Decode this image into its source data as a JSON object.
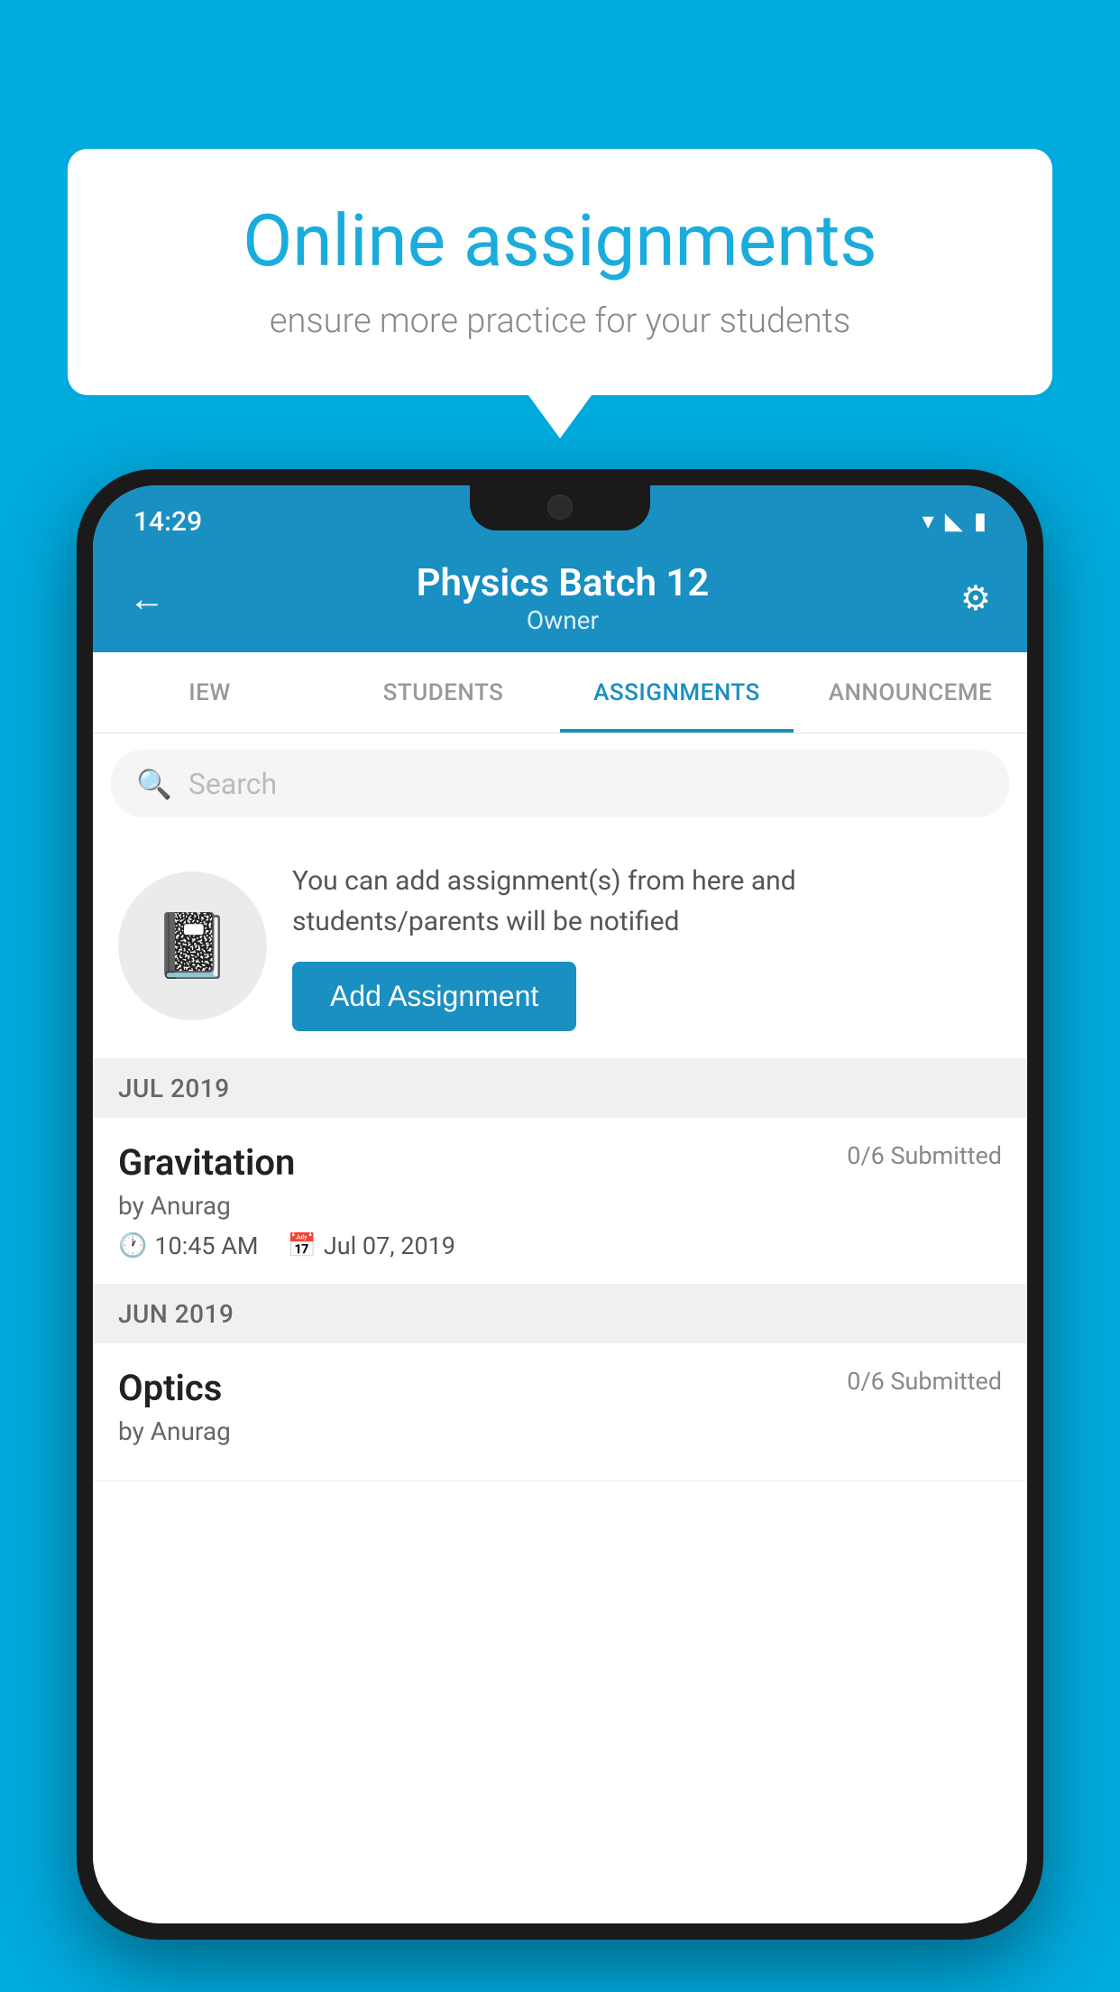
{
  "background_color": "#00AADD",
  "speech_bubble": {
    "title": "Online assignments",
    "subtitle": "ensure more practice for your students"
  },
  "status_bar": {
    "time": "14:29",
    "icons": [
      "wifi",
      "signal",
      "battery"
    ]
  },
  "header": {
    "title": "Physics Batch 12",
    "subtitle": "Owner",
    "back_label": "←",
    "settings_label": "⚙"
  },
  "tabs": [
    {
      "id": "iew",
      "label": "IEW",
      "active": false
    },
    {
      "id": "students",
      "label": "STUDENTS",
      "active": false
    },
    {
      "id": "assignments",
      "label": "ASSIGNMENTS",
      "active": true
    },
    {
      "id": "announcements",
      "label": "ANNOUNCEMENTS",
      "active": false
    }
  ],
  "search": {
    "placeholder": "Search"
  },
  "promo": {
    "text": "You can add assignment(s) from here and students/parents will be notified",
    "button_label": "Add Assignment"
  },
  "sections": [
    {
      "label": "JUL 2019",
      "assignments": [
        {
          "name": "Gravitation",
          "submitted": "0/6 Submitted",
          "author": "by Anurag",
          "time": "10:45 AM",
          "date": "Jul 07, 2019"
        }
      ]
    },
    {
      "label": "JUN 2019",
      "assignments": [
        {
          "name": "Optics",
          "submitted": "0/6 Submitted",
          "author": "by Anurag",
          "time": "",
          "date": ""
        }
      ]
    }
  ]
}
